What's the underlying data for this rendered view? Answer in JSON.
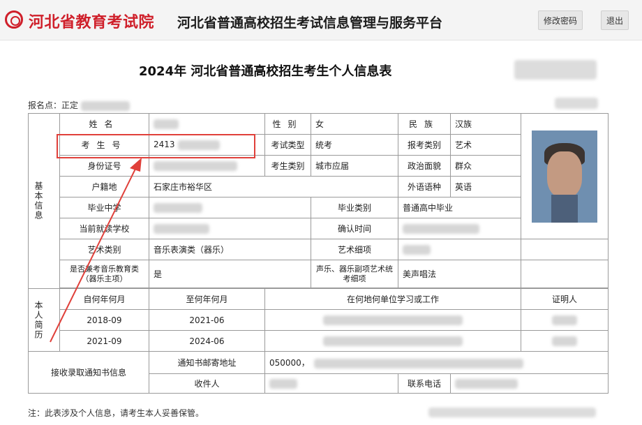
{
  "header": {
    "brand": "河北省教育考试院",
    "platform_title": "河北省普通高校招生考试信息管理与服务平台",
    "change_password_button": "修改密码",
    "logout_button": "退出"
  },
  "document": {
    "title": "2024年 河北省普通高校招生考生个人信息表",
    "registration_label": "报名点：",
    "registration_value": "正定",
    "footnote": "注：此表涉及个人信息，请考生本人妥善保管。"
  },
  "basic_info": {
    "section_label": "基本信息",
    "name_label": "姓名",
    "gender_label": "性别",
    "gender_value": "女",
    "ethnicity_label": "民族",
    "ethnicity_value": "汉族",
    "exam_no_label": "考生号",
    "exam_no_value": "2413",
    "exam_type_label": "考试类型",
    "exam_type_value": "统考",
    "apply_category_label": "报考类别",
    "apply_category_value": "艺术",
    "id_label": "身份证号",
    "student_category_label": "考生类别",
    "student_category_value": "城市应届",
    "political_label": "政治面貌",
    "political_value": "群众",
    "hukou_label": "户籍地",
    "hukou_value": "石家庄市裕华区",
    "foreign_lang_label": "外语语种",
    "foreign_lang_value": "英语",
    "grad_school_label": "毕业中学",
    "grad_type_label": "毕业类别",
    "grad_type_value": "普通高中毕业",
    "current_school_label": "当前就读学校",
    "confirm_time_label": "确认时间",
    "art_category_label": "艺术类别",
    "art_category_value": "音乐表演类（器乐）",
    "art_subitem_label": "艺术细项",
    "music_edu_label": "是否兼考音乐教育类（器乐主项）",
    "music_edu_value": "是",
    "vocal_label": "声乐、器乐副项艺术统考细项",
    "vocal_value": "美声唱法"
  },
  "resume": {
    "section_label": "本人简历",
    "col_from": "自何年何月",
    "col_to": "至何年何月",
    "col_where": "在何地何单位学习或工作",
    "col_witness": "证明人",
    "rows": [
      {
        "from": "2018-09",
        "to": "2021-06"
      },
      {
        "from": "2021-09",
        "to": "2024-06"
      }
    ]
  },
  "notice": {
    "section_label": "接收录取通知书信息",
    "address_label": "通知书邮寄地址",
    "address_value": "050000，",
    "recipient_label": "收件人",
    "phone_label": "联系电话"
  }
}
